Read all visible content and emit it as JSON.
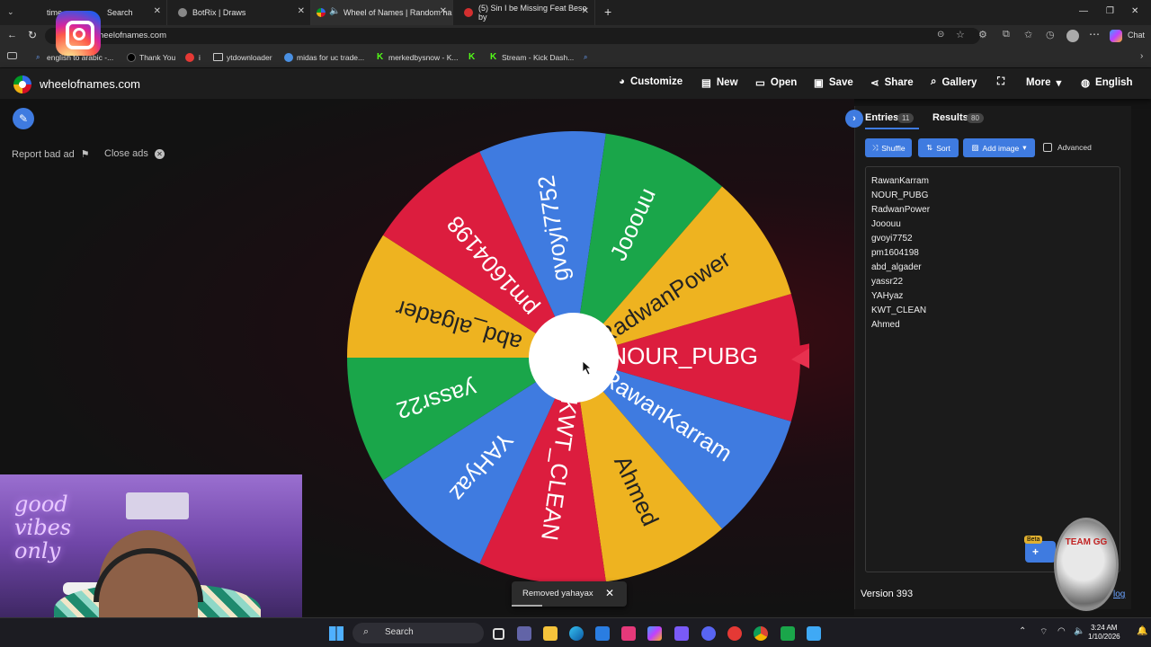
{
  "browser": {
    "tabs": [
      {
        "label": "time",
        "label2": "Search"
      },
      {
        "label": "BotRix | Draws"
      },
      {
        "label": "Wheel of Names | Random na"
      },
      {
        "label": "(5) Sin I be Missing Feat Beso by"
      }
    ],
    "new_tab": "+",
    "url": "heelofnames.com",
    "chat_label": "Chat",
    "bookmarks": [
      "english to arabic -...",
      "Thank You",
      "i",
      "ytdownloader",
      "midas for uc trade...",
      "merkedbysnow - K...",
      "Stream - Kick Dash..."
    ]
  },
  "site": {
    "name": "wheelofnames.com",
    "nav": [
      "Customize",
      "New",
      "Open",
      "Save",
      "Share",
      "Gallery",
      "More",
      "English"
    ]
  },
  "ads": {
    "report": "Report bad ad",
    "close": "Close ads"
  },
  "wheel": {
    "segments": [
      {
        "name": "NOUR_PUBG",
        "color": "#dc1d3e"
      },
      {
        "name": "RawanKarram",
        "color": "#3f7be0"
      },
      {
        "name": "Ahmed",
        "color": "#eeb320"
      },
      {
        "name": "KWT_CLEAN",
        "color": "#dc1d3e"
      },
      {
        "name": "YAHyaz",
        "color": "#3f7be0"
      },
      {
        "name": "yassr22",
        "color": "#1aa64a"
      },
      {
        "name": "abd_algader",
        "color": "#eeb320"
      },
      {
        "name": "pm1604198",
        "color": "#dc1d3e"
      },
      {
        "name": "gvoyi7752",
        "color": "#3f7be0"
      },
      {
        "name": "Jooouu",
        "color": "#1aa64a"
      },
      {
        "name": "RadwanPower",
        "color": "#eeb320"
      }
    ]
  },
  "panel": {
    "tab_entries": "Entries",
    "entries_count": "11",
    "tab_results": "Results",
    "results_count": "80",
    "shuffle": "Shuffle",
    "sort": "Sort",
    "add_image": "Add image",
    "advanced": "Advanced",
    "entries": [
      "RawanKarram",
      "NOUR_PUBG",
      "RadwanPower",
      "Jooouu",
      "gvoyi7752",
      "pm1604198",
      "abd_algader",
      "yassr22",
      "YAHyaz",
      "KWT_CLEAN",
      "Ahmed"
    ],
    "version": "Version 393",
    "beta": "Beta",
    "changelog_fragment": "log"
  },
  "overlay": {
    "team_gg": "TEAM GG",
    "neon_sign": "good vibes only"
  },
  "toast": {
    "message": "Removed yahayax",
    "close": "✕"
  },
  "taskbar": {
    "search": "Search",
    "time": "3:24 AM",
    "date": "1/10/2026"
  }
}
